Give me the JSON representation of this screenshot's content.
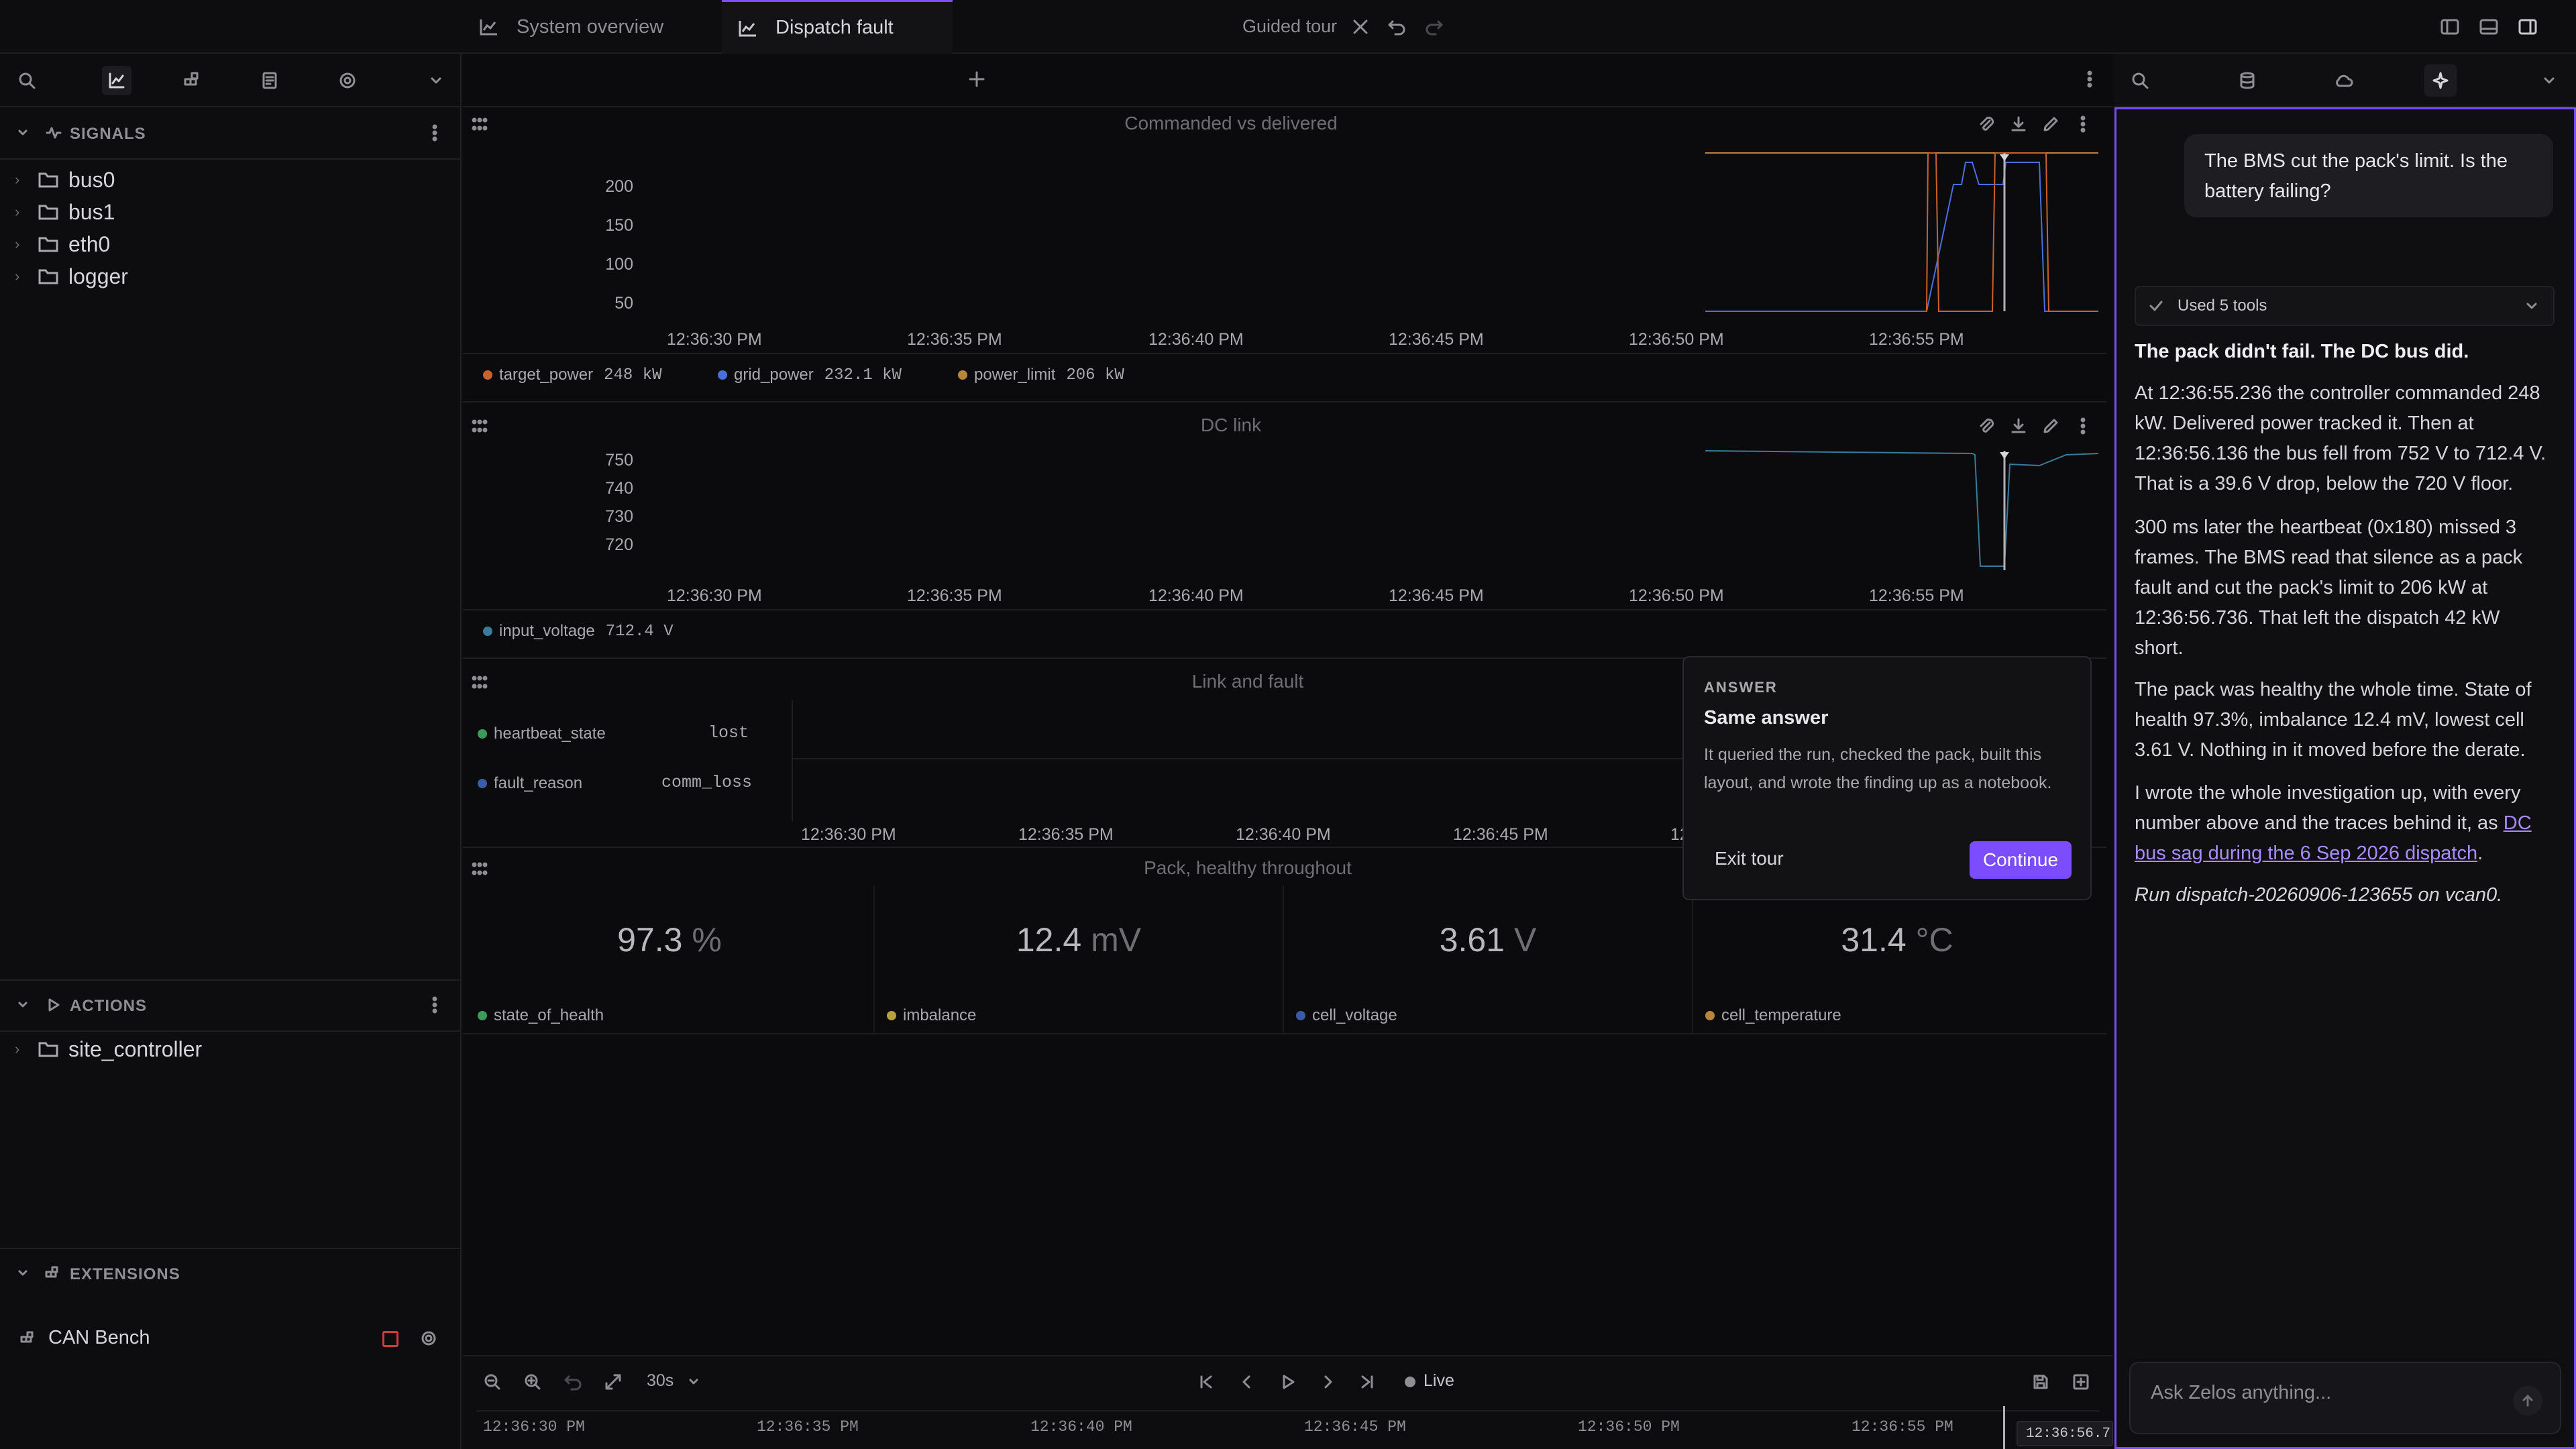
{
  "topbar": {
    "title": "Guided tour"
  },
  "sidebar": {
    "signals_header": "SIGNALS",
    "signals": [
      "bus0",
      "bus1",
      "eth0",
      "logger"
    ],
    "actions_header": "ACTIONS",
    "actions": [
      "site_controller"
    ],
    "extensions_header": "EXTENSIONS",
    "extension_name": "CAN Bench"
  },
  "tabs": [
    {
      "label": "System overview"
    },
    {
      "label": "Dispatch fault"
    }
  ],
  "panels": {
    "power": {
      "title": "Commanded vs delivered",
      "yticks": [
        "200",
        "150",
        "100",
        "50"
      ],
      "xticks": [
        "12:36:30 PM",
        "12:36:35 PM",
        "12:36:40 PM",
        "12:36:45 PM",
        "12:36:50 PM",
        "12:36:55 PM"
      ],
      "legend": [
        {
          "name": "target_power",
          "value": "248 kW",
          "color": "#c8622c"
        },
        {
          "name": "grid_power",
          "value": "232.1 kW",
          "color": "#4a6fd8"
        },
        {
          "name": "power_limit",
          "value": "206 kW",
          "color": "#b8863b"
        }
      ]
    },
    "dclink": {
      "title": "DC link",
      "yticks": [
        "750",
        "740",
        "730",
        "720"
      ],
      "xticks": [
        "12:36:30 PM",
        "12:36:35 PM",
        "12:36:40 PM",
        "12:36:45 PM",
        "12:36:50 PM",
        "12:36:55 PM"
      ],
      "legend": [
        {
          "name": "input_voltage",
          "value": "712.4 V",
          "color": "#3a7a9a"
        }
      ]
    },
    "link": {
      "title": "Link and fault",
      "rows": [
        {
          "name": "heartbeat_state",
          "value": "lost",
          "color": "#3c9a5a"
        },
        {
          "name": "fault_reason",
          "value": "comm_loss",
          "color": "#3a5aaa"
        }
      ],
      "xticks": [
        "12:36:30 PM",
        "12:36:35 PM",
        "12:36:40 PM",
        "12:36:45 PM",
        "12"
      ]
    },
    "pack": {
      "title": "Pack, healthy throughout",
      "kpis": [
        {
          "value": "97.3",
          "unit": "%",
          "name": "state_of_health",
          "color": "#3c9a5a"
        },
        {
          "value": "12.4",
          "unit": "mV",
          "name": "imbalance",
          "color": "#b8a33b"
        },
        {
          "value": "3.61",
          "unit": "V",
          "name": "cell_voltage",
          "color": "#3a5aaa"
        },
        {
          "value": "31.4",
          "unit": "°C",
          "name": "cell_temperature",
          "color": "#b8863b"
        }
      ]
    }
  },
  "popover": {
    "eyebrow": "ANSWER",
    "title": "Same answer",
    "body": "It queried the run, checked the pack, built this layout, and wrote the finding up as a notebook.",
    "exit": "Exit tour",
    "continue": "Continue"
  },
  "timebar": {
    "window": "30s",
    "live": "Live",
    "ticks": [
      "12:36:30 PM",
      "12:36:35 PM",
      "12:36:40 PM",
      "12:36:45 PM",
      "12:36:50 PM",
      "12:36:55 PM"
    ],
    "cursor": "12:36:56.7"
  },
  "assistant": {
    "user_message": "The BMS cut the pack's limit. Is the battery failing?",
    "tools_label": "Used 5 tools",
    "heading": "The pack didn't fail. The DC bus did.",
    "p1": "At 12:36:55.236 the controller commanded 248 kW. Delivered power tracked it. Then at 12:36:56.136 the bus fell from 752 V to 712.4 V. That is a 39.6 V drop, below the 720 V floor.",
    "p2": "300 ms later the heartbeat (0x180) missed 3 frames. The BMS read that silence as a pack fault and cut the pack's limit to 206 kW at 12:36:56.736. That left the dispatch 42 kW short.",
    "p3": "The pack was healthy the whole time. State of health 97.3%, imbalance 12.4 mV, lowest cell 3.61 V. Nothing in it moved before the derate.",
    "p4_before": "I wrote the whole investigation up, with every number above and the traces behind it, as ",
    "p4_link": "DC bus sag during the 6 Sep 2026 dispatch",
    "p4_after": ".",
    "p5": "Run dispatch-20260906-123655 on vcan0.",
    "input_placeholder": "Ask Zelos anything..."
  }
}
